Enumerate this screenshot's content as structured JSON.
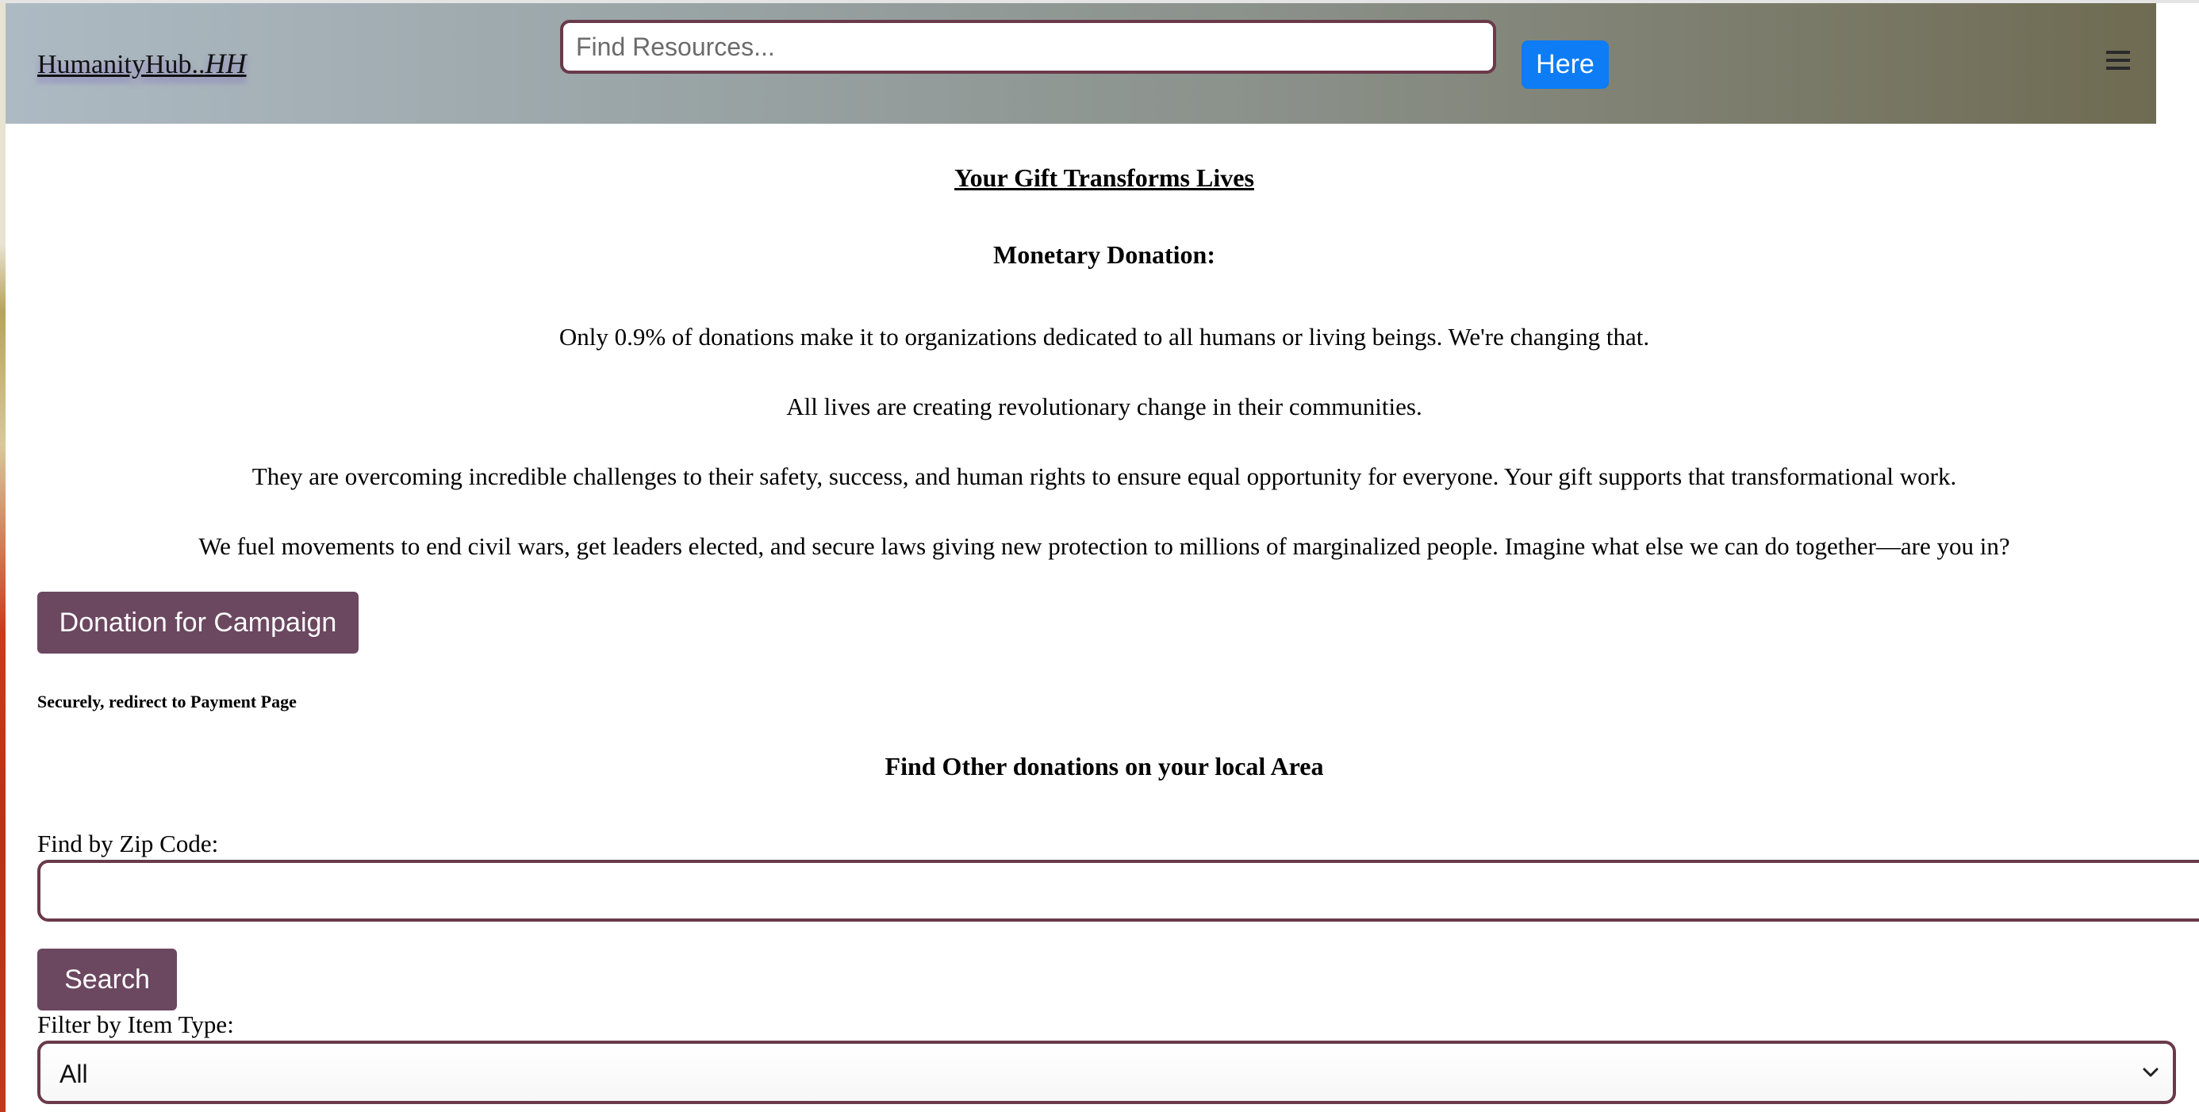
{
  "header": {
    "brand": "HumanityHub..",
    "brand_mark": "HH",
    "search_placeholder": "Find Resources...",
    "search_button": "Here",
    "menu_icon": "hamburger-menu-icon"
  },
  "main": {
    "title": "Your Gift Transforms Lives",
    "subtitle": "Monetary Donation:",
    "paragraphs": [
      "Only 0.9% of donations make it to organizations dedicated to all humans or living beings. We're changing that.",
      "All lives are creating revolutionary change in their communities.",
      "They are overcoming incredible challenges to their safety, success, and human rights to ensure equal opportunity for everyone. Your gift supports that transformational work.",
      "We fuel movements to end civil wars, get leaders elected, and secure laws giving new protection to millions of marginalized people. Imagine what else we can do together—are you in?"
    ],
    "donate_button": "Donation for Campaign",
    "secure_note": "Securely, redirect to Payment Page"
  },
  "local": {
    "title": "Find Other donations on your local Area",
    "zip_label": "Find by Zip Code:",
    "zip_value": "",
    "search_button": "Search",
    "filter_label": "Filter by Item Type:",
    "filter_value": "All"
  },
  "colors": {
    "accent_button": "#0d7cf5",
    "primary_button": "#6b4760",
    "input_border": "#6a3a4a"
  }
}
